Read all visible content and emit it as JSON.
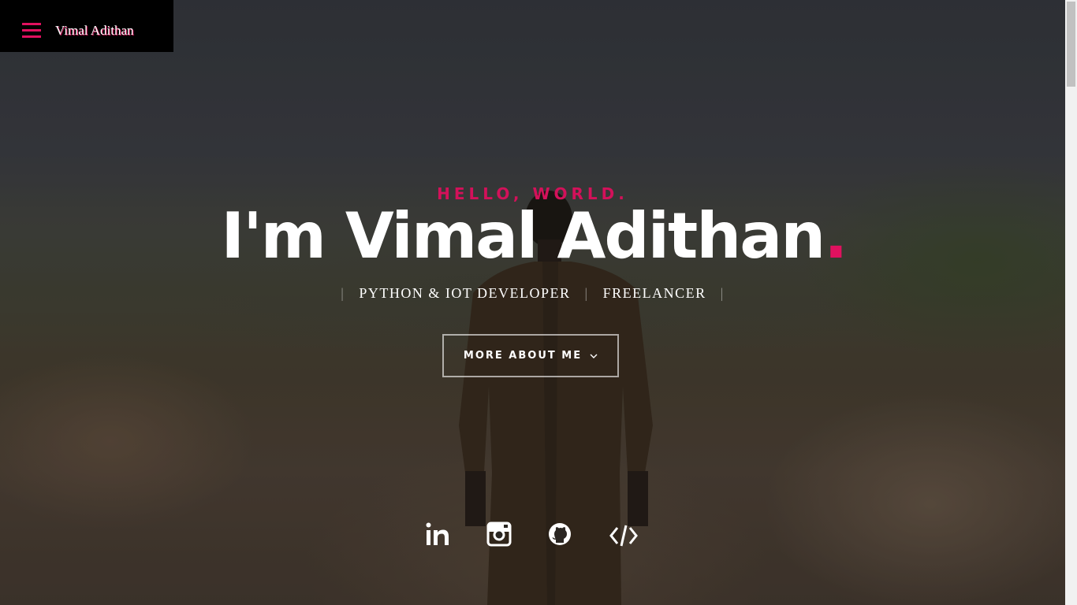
{
  "header": {
    "site_name": "Vimal Adithan",
    "accent_color": "#e0115f",
    "menu_icon": "hamburger-menu-icon"
  },
  "intro": {
    "pretitle": "HELLO, WORLD.",
    "title_text": "I'm Vimal Adithan",
    "title_dot": ".",
    "roles": [
      "PYTHON & IOT DEVELOPER",
      "FREELANCER"
    ],
    "more_button_label": "MORE ABOUT ME",
    "more_button_icon": "chevron-down-icon"
  },
  "social": {
    "items": [
      {
        "name": "linkedin",
        "icon": "linkedin-icon"
      },
      {
        "name": "instagram",
        "icon": "instagram-icon"
      },
      {
        "name": "github",
        "icon": "github-icon"
      },
      {
        "name": "code",
        "icon": "code-icon"
      }
    ]
  },
  "colors": {
    "accent": "#e0115f",
    "text": "#ffffff",
    "header_bg": "#000000"
  }
}
